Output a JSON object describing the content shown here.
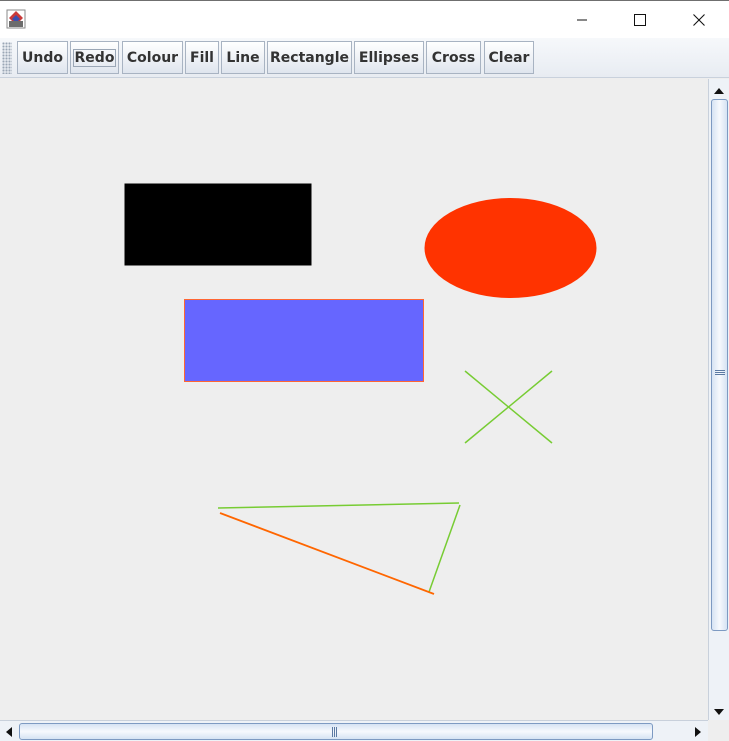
{
  "window": {
    "controls": {
      "minimize_icon": "minimize-icon",
      "maximize_icon": "maximize-icon",
      "close_icon": "close-icon"
    }
  },
  "toolbar": {
    "buttons": [
      {
        "label": "Undo"
      },
      {
        "label": "Redo"
      },
      {
        "label": "Colour"
      },
      {
        "label": "Fill"
      },
      {
        "label": "Line"
      },
      {
        "label": "Rectangle"
      },
      {
        "label": "Ellipses"
      },
      {
        "label": "Cross"
      },
      {
        "label": "Clear"
      }
    ]
  },
  "canvas": {
    "background": "#eeeeee",
    "shapes": [
      {
        "kind": "rectangle",
        "fill": "#000000",
        "stroke": "#000000"
      },
      {
        "kind": "ellipse",
        "fill": "#ff3300",
        "stroke": "#ff3300"
      },
      {
        "kind": "rectangle",
        "fill": "#6666ff",
        "stroke": "#ff6633"
      },
      {
        "kind": "cross",
        "stroke": "#77cc33"
      },
      {
        "kind": "line",
        "stroke": "#77cc33"
      },
      {
        "kind": "line",
        "stroke": "#77cc33"
      },
      {
        "kind": "line",
        "stroke": "#ff6600"
      }
    ]
  },
  "colors": {
    "accent_scroll": "#7d9ac2",
    "toolbar_text": "#333333"
  }
}
